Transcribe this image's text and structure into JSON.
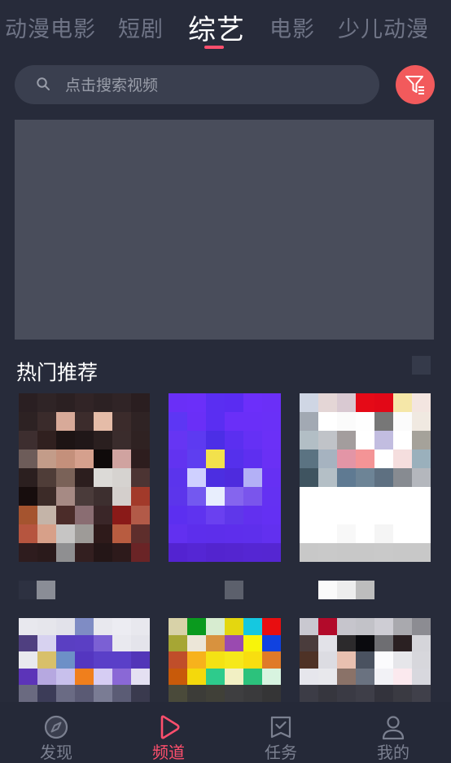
{
  "tabs": [
    {
      "label": "动漫电影",
      "active": false
    },
    {
      "label": "短剧",
      "active": false
    },
    {
      "label": "综艺",
      "active": true
    },
    {
      "label": "电影",
      "active": false
    },
    {
      "label": "少儿动漫",
      "active": false
    }
  ],
  "search": {
    "placeholder": "点击搜索视频",
    "value": ""
  },
  "section": {
    "title": "热门推荐"
  },
  "nav": [
    {
      "label": "发现",
      "icon": "compass-icon",
      "active": false
    },
    {
      "label": "频道",
      "icon": "play-icon",
      "active": true
    },
    {
      "label": "任务",
      "icon": "task-icon",
      "active": false
    },
    {
      "label": "我的",
      "icon": "user-icon",
      "active": false
    }
  ],
  "colors": {
    "background": "#272b3a",
    "accent": "#ff4f6d",
    "filter_button": "#f25a5c",
    "inactive_text": "#6f7486"
  }
}
